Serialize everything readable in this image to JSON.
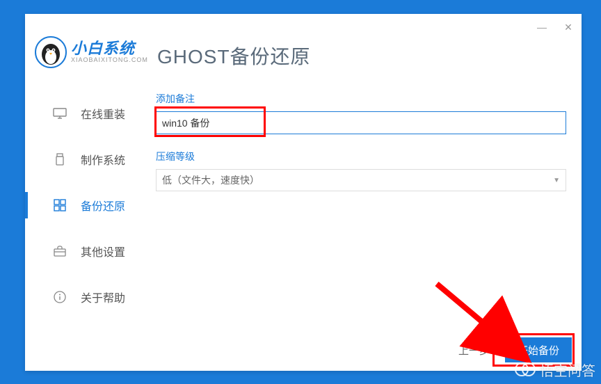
{
  "window": {
    "minimize": "—",
    "close": "✕"
  },
  "logo": {
    "main": "小白系统",
    "sub": "XIAOBAIXITONG.COM"
  },
  "page_title": "GHOST备份还原",
  "sidebar": {
    "items": [
      {
        "label": "在线重装"
      },
      {
        "label": "制作系统"
      },
      {
        "label": "备份还原"
      },
      {
        "label": "其他设置"
      },
      {
        "label": "关于帮助"
      }
    ],
    "active_index": 2
  },
  "fields": {
    "note_label": "添加备注",
    "note_value": "win10 备份",
    "compress_label": "压缩等级",
    "compress_value": "低（文件大，速度快）"
  },
  "actions": {
    "prev": "上一步",
    "start": "开始备份"
  },
  "watermark": "悟空问答"
}
